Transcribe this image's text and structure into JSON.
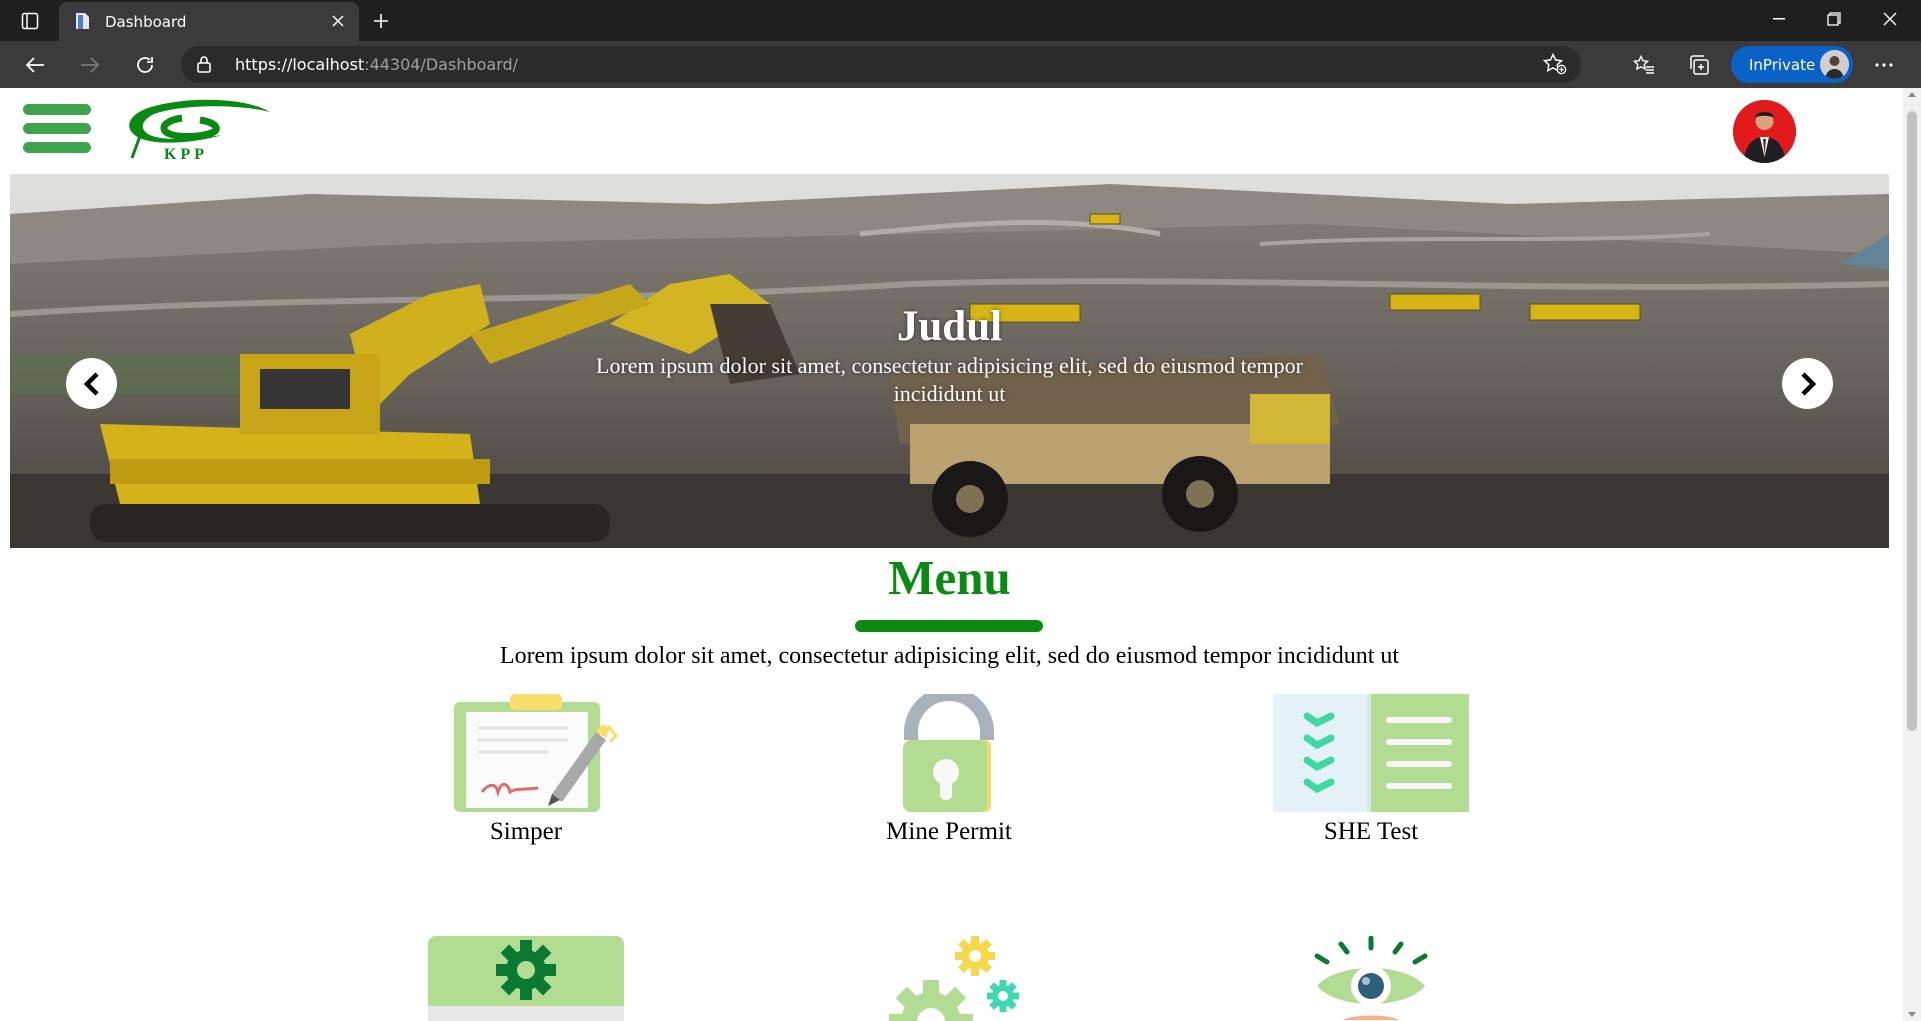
{
  "browser": {
    "tab_title": "Dashboard",
    "url_host": "https://localhost",
    "url_rest": ":44304/Dashboard/",
    "inprivate_label": "InPrivate"
  },
  "header": {
    "logo_text": "KPP"
  },
  "carousel": {
    "title": "Judul",
    "description": "Lorem ipsum dolor sit amet, consectetur adipisicing elit, sed do eiusmod tempor incididunt ut"
  },
  "menu": {
    "title": "Menu",
    "description": "Lorem ipsum dolor sit amet, consectetur adipisicing elit, sed do eiusmod tempor incididunt ut",
    "items": [
      {
        "label": "Simper",
        "icon": "clipboard-sign-icon"
      },
      {
        "label": "Mine Permit",
        "icon": "padlock-icon"
      },
      {
        "label": "SHE Test",
        "icon": "checklist-icon"
      },
      {
        "label": "",
        "icon": "gear-panel-icon"
      },
      {
        "label": "",
        "icon": "gears-icon"
      },
      {
        "label": "",
        "icon": "eye-icon"
      }
    ]
  },
  "colors": {
    "brand_green": "#0a8a12",
    "hamburger_green": "#3fa34d",
    "tile_green": "#b3dc93",
    "inprivate_blue": "#0a62c7"
  }
}
